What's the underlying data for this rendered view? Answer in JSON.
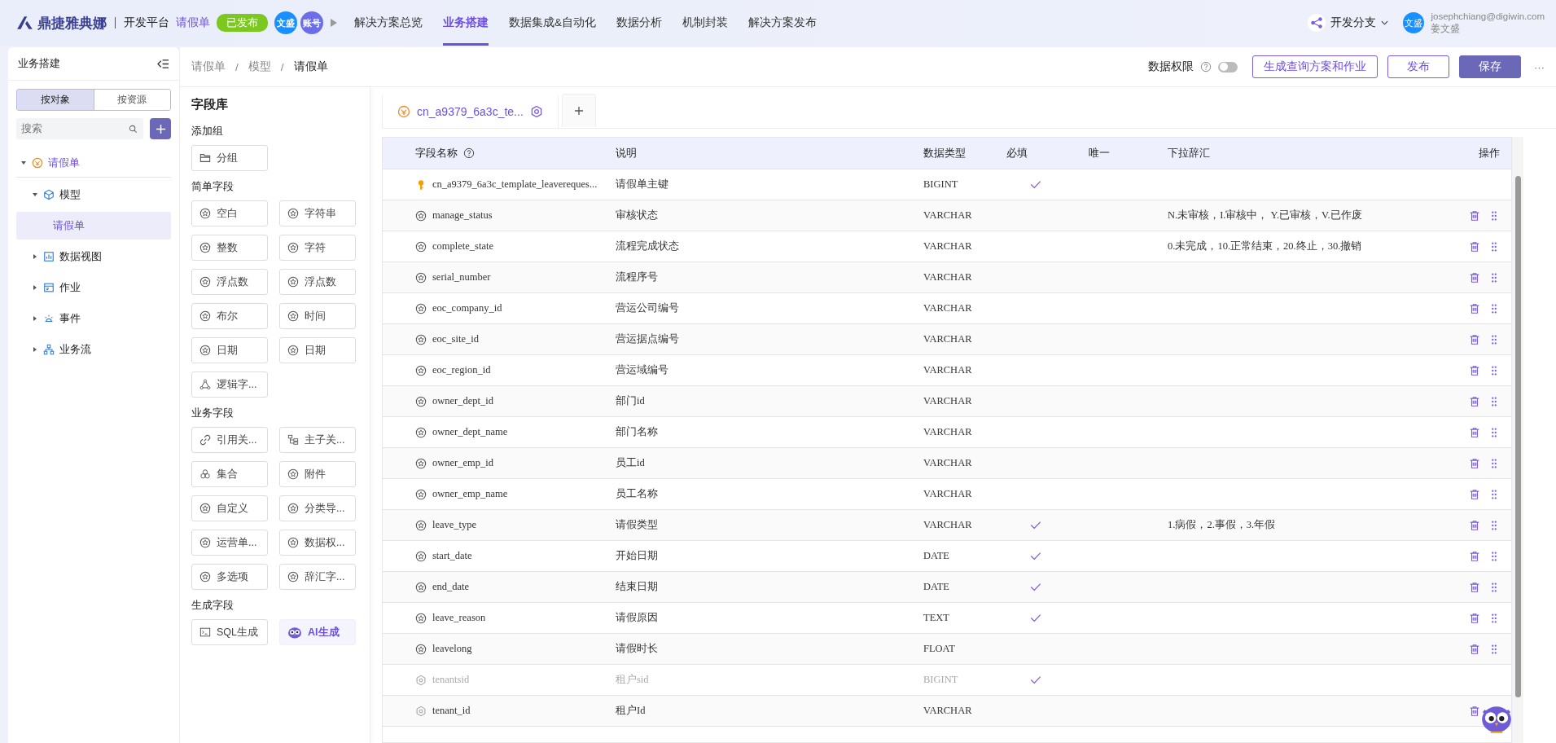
{
  "top_bar": {
    "logo": "鼎捷雅典娜",
    "platform": "开发平台",
    "app_name": "请假单",
    "status_badge": "已发布",
    "avatars": [
      "文盛",
      "账号"
    ],
    "nav": [
      {
        "label": "解决方案总览",
        "selected": false
      },
      {
        "label": "业务搭建",
        "selected": true
      },
      {
        "label": "数据集成&自动化",
        "selected": false
      },
      {
        "label": "数据分析",
        "selected": false
      },
      {
        "label": "机制封装",
        "selected": false
      },
      {
        "label": "解决方案发布",
        "selected": false
      }
    ],
    "branch": "开发分支",
    "user": {
      "avatar": "文盛",
      "email": "josephchiang@digiwin.com",
      "name": "姜文盛"
    }
  },
  "sidebar": {
    "title": "业务搭建",
    "segments": [
      {
        "label": "按对象",
        "selected": true
      },
      {
        "label": "按资源",
        "selected": false
      }
    ],
    "search": {
      "placeholder": "搜索"
    },
    "tree": [
      {
        "label": "请假单",
        "kind": "object",
        "expanded": true,
        "selected": false,
        "children": [
          {
            "label": "模型",
            "kind": "model",
            "expanded": true,
            "selected": false,
            "children": [
              {
                "label": "请假单",
                "selected": true
              }
            ]
          },
          {
            "label": "数据视图",
            "kind": "view",
            "expanded": false,
            "selected": false
          },
          {
            "label": "作业",
            "kind": "job",
            "expanded": false,
            "selected": false
          },
          {
            "label": "事件",
            "kind": "event",
            "expanded": false,
            "selected": false
          },
          {
            "label": "业务流",
            "kind": "flow",
            "expanded": false,
            "selected": false
          }
        ]
      }
    ]
  },
  "breadcrumb": [
    "请假单",
    "模型",
    "请假单"
  ],
  "breadcrumb_separator": "/",
  "toolbar": {
    "permission_label": "数据权限",
    "permission_on": false,
    "buttons": [
      {
        "label": "生成查询方案和作业",
        "kind": "outline"
      },
      {
        "label": "发布",
        "kind": "outline"
      },
      {
        "label": "保存",
        "kind": "primary"
      }
    ],
    "more": "···"
  },
  "field_library": {
    "title": "字段库",
    "sections": [
      {
        "title": "添加组",
        "items": [
          {
            "label": "分组",
            "kind": "folder"
          }
        ]
      },
      {
        "title": "简单字段",
        "items": [
          {
            "label": "空白",
            "kind": "field"
          },
          {
            "label": "字符串",
            "kind": "field"
          },
          {
            "label": "整数",
            "kind": "field"
          },
          {
            "label": "字符",
            "kind": "field"
          },
          {
            "label": "浮点数",
            "kind": "field"
          },
          {
            "label": "浮点数",
            "kind": "field"
          },
          {
            "label": "布尔",
            "kind": "field"
          },
          {
            "label": "时间",
            "kind": "field"
          },
          {
            "label": "日期",
            "kind": "field"
          },
          {
            "label": "日期",
            "kind": "field"
          },
          {
            "label": "逻辑字...",
            "kind": "logic"
          }
        ]
      },
      {
        "title": "业务字段",
        "items": [
          {
            "label": "引用关...",
            "kind": "link"
          },
          {
            "label": "主子关...",
            "kind": "tree"
          },
          {
            "label": "集合",
            "kind": "set"
          },
          {
            "label": "附件",
            "kind": "field"
          },
          {
            "label": "自定义",
            "kind": "field"
          },
          {
            "label": "分类导...",
            "kind": "field"
          },
          {
            "label": "运营单...",
            "kind": "field"
          },
          {
            "label": "数据权...",
            "kind": "field"
          },
          {
            "label": "多选项",
            "kind": "field"
          },
          {
            "label": "辞汇字...",
            "kind": "field"
          }
        ]
      },
      {
        "title": "生成字段",
        "items": [
          {
            "label": "SQL生成",
            "kind": "sql"
          },
          {
            "label": "AI生成",
            "kind": "ai"
          }
        ]
      }
    ]
  },
  "model_tabs": [
    {
      "label": "cn_a9379_6a3c_te...",
      "selected": true
    }
  ],
  "table": {
    "columns": [
      "字段名称",
      "说明",
      "数据类型",
      "必填",
      "唯一",
      "下拉辞汇",
      "操作"
    ],
    "rows": [
      {
        "kind": "primary",
        "name": "cn_a9379_6a3c_template_leavereques...",
        "description": "请假单主键",
        "type": "BIGINT",
        "required": true,
        "disabled": false,
        "options": "",
        "deletable": false,
        "draggable": false
      },
      {
        "kind": "field",
        "name": "manage_status",
        "description": "审核状态",
        "type": "VARCHAR",
        "required": false,
        "disabled": false,
        "options": "N.未审核，I.审核中， Y.已审核，V.已作废",
        "deletable": true,
        "draggable": true
      },
      {
        "kind": "field",
        "name": "complete_state",
        "description": "流程完成状态",
        "type": "VARCHAR",
        "required": false,
        "disabled": false,
        "options": "0.未完成，10.正常结束，20.终止，30.撤销",
        "deletable": true,
        "draggable": true
      },
      {
        "kind": "field",
        "name": "serial_number",
        "description": "流程序号",
        "type": "VARCHAR",
        "required": false,
        "disabled": false,
        "options": "",
        "deletable": true,
        "draggable": true
      },
      {
        "kind": "field",
        "name": "eoc_company_id",
        "description": "营运公司编号",
        "type": "VARCHAR",
        "required": false,
        "disabled": false,
        "options": "",
        "deletable": true,
        "draggable": true
      },
      {
        "kind": "field",
        "name": "eoc_site_id",
        "description": "营运据点编号",
        "type": "VARCHAR",
        "required": false,
        "disabled": false,
        "options": "",
        "deletable": true,
        "draggable": true
      },
      {
        "kind": "field",
        "name": "eoc_region_id",
        "description": "营运域编号",
        "type": "VARCHAR",
        "required": false,
        "disabled": false,
        "options": "",
        "deletable": true,
        "draggable": true
      },
      {
        "kind": "field",
        "name": "owner_dept_id",
        "description": "部门id",
        "type": "VARCHAR",
        "required": false,
        "disabled": false,
        "options": "",
        "deletable": true,
        "draggable": true
      },
      {
        "kind": "field",
        "name": "owner_dept_name",
        "description": "部门名称",
        "type": "VARCHAR",
        "required": false,
        "disabled": false,
        "options": "",
        "deletable": true,
        "draggable": true
      },
      {
        "kind": "field",
        "name": "owner_emp_id",
        "description": "员工id",
        "type": "VARCHAR",
        "required": false,
        "disabled": false,
        "options": "",
        "deletable": true,
        "draggable": true
      },
      {
        "kind": "field",
        "name": "owner_emp_name",
        "description": "员工名称",
        "type": "VARCHAR",
        "required": false,
        "disabled": false,
        "options": "",
        "deletable": true,
        "draggable": true
      },
      {
        "kind": "field",
        "name": "leave_type",
        "description": "请假类型",
        "type": "VARCHAR",
        "required": true,
        "disabled": false,
        "options": "1.病假，2.事假，3.年假",
        "deletable": true,
        "draggable": true
      },
      {
        "kind": "field",
        "name": "start_date",
        "description": "开始日期",
        "type": "DATE",
        "required": true,
        "disabled": false,
        "options": "",
        "deletable": true,
        "draggable": true
      },
      {
        "kind": "field",
        "name": "end_date",
        "description": "结束日期",
        "type": "DATE",
        "required": true,
        "disabled": false,
        "options": "",
        "deletable": true,
        "draggable": true
      },
      {
        "kind": "field",
        "name": "leave_reason",
        "description": "请假原因",
        "type": "TEXT",
        "required": true,
        "disabled": false,
        "options": "",
        "deletable": true,
        "draggable": true
      },
      {
        "kind": "field",
        "name": "leavelong",
        "description": "请假时长",
        "type": "FLOAT",
        "required": false,
        "disabled": false,
        "options": "",
        "deletable": true,
        "draggable": true
      },
      {
        "kind": "system",
        "name": "tenantsid",
        "description": "租户sid",
        "type": "BIGINT",
        "required": true,
        "disabled": true,
        "options": "",
        "deletable": false,
        "draggable": false
      },
      {
        "kind": "system",
        "name": "tenant_id",
        "description": "租户Id",
        "type": "VARCHAR",
        "required": false,
        "disabled": false,
        "options": "",
        "deletable": true,
        "draggable": false
      }
    ]
  }
}
